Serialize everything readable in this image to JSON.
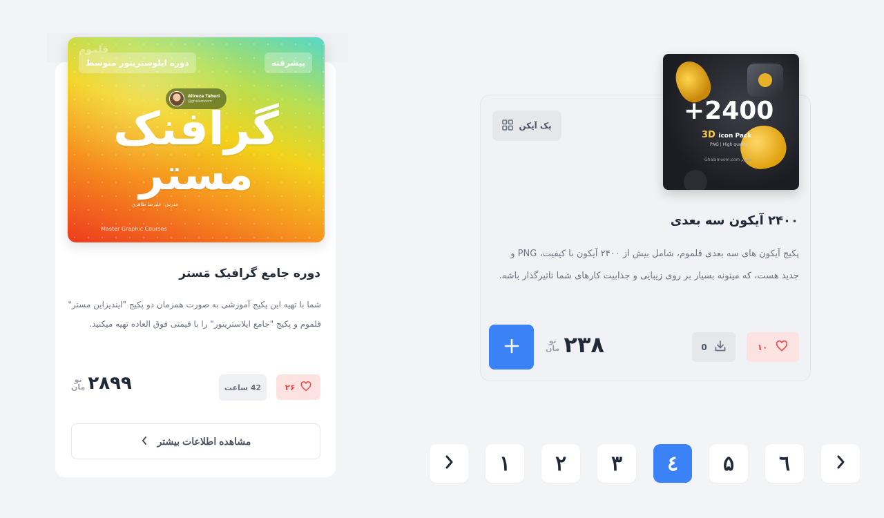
{
  "course_card": {
    "cover": {
      "logo": "قلموم",
      "badge_advanced": "پیشرفته",
      "badge_level": "دوره ایلوستریتور متوسط",
      "instructor_name": "Alireza Taheri",
      "instructor_handle": "@ghalamoom",
      "title_line1": "گرافنک",
      "title_line2": "مستر",
      "subtitle": "مدرس: علیرضا طاهری",
      "footer": "Master Graphic Courses"
    },
    "title": "دوره جامع گرافیک مَستر",
    "description": "شما با تهیه این پکیج آموزشی به صورت همزمان دو پکیج \"ایندیزاین مستر\" قلموم و پکیج \"جامع ایلاستریتور\" را با قیمتی فوق العاده تهیه میکنید.",
    "likes": "۲۶",
    "duration": "42 ساعت",
    "price": "۲۸۹۹",
    "currency_line1": "تو",
    "currency_line2": "مان",
    "more_button": "مشاهده اطلاعات بیشتر"
  },
  "pack_card": {
    "cover": {
      "count": "+2400",
      "label": "3D",
      "label_rest": "icon Pack",
      "quality": "PNG | High quality",
      "brand": "Ghalamoom.com  قلموم"
    },
    "tag": "پک آیکن",
    "title": "۲۴۰۰ آیکون سه بعدی",
    "description": "پکیج آیکون های سه بعدی قلموم، شامل بیش از ۲۴۰۰ آیکون با کیفیت، PNG و جدید هست، که میتونه بسیار بر روی زیبایی و جذابیت کارهای شما تاثیرگذار باشه.",
    "likes": "۱۰",
    "downloads": "0",
    "price": "۲۳۸",
    "currency_line1": "تو",
    "currency_line2": "مان"
  },
  "pagination": {
    "pages": [
      "۱",
      "۲",
      "۳",
      "٤",
      "۵",
      "٦"
    ],
    "active_page": "٤"
  },
  "colors": {
    "accent": "#3b82f6",
    "like_bg": "#fde2e2",
    "like_fg": "#ef4444",
    "page_bg": "#f3f4f6"
  }
}
